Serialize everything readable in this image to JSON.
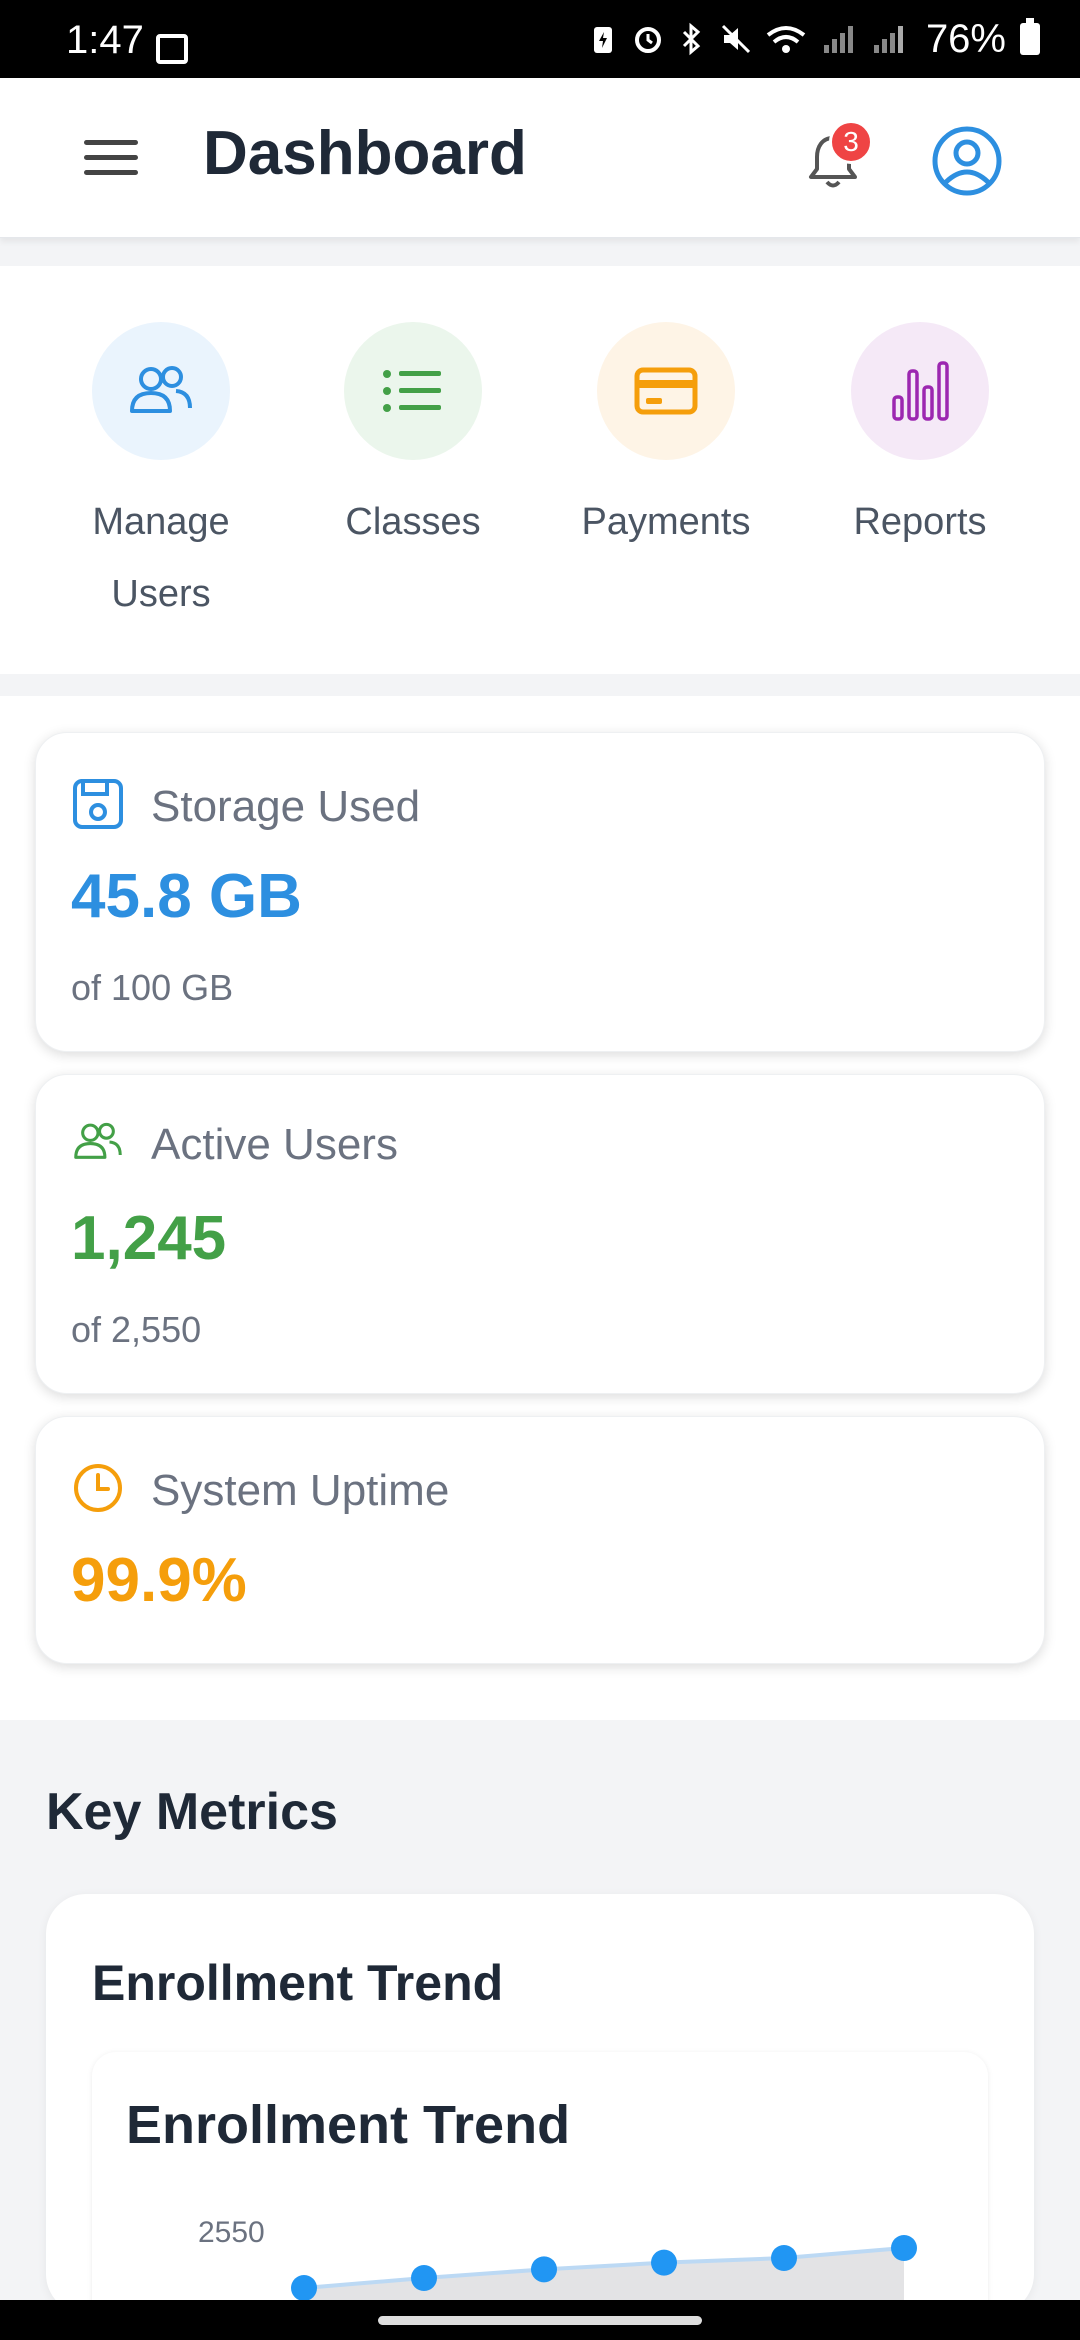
{
  "status_bar": {
    "time": "1:47",
    "battery": "76%"
  },
  "header": {
    "title": "Dashboard",
    "notification_count": "3"
  },
  "quick_actions": [
    {
      "label": "Manage Users",
      "icon": "users-icon",
      "color": "#2d8fe0",
      "bg": "#eaf4fd"
    },
    {
      "label": "Classes",
      "icon": "list-icon",
      "color": "#43a047",
      "bg": "#ebf6ec"
    },
    {
      "label": "Payments",
      "icon": "credit-card-icon",
      "color": "#f59e0b",
      "bg": "#fef4e6"
    },
    {
      "label": "Reports",
      "icon": "bar-chart-icon",
      "color": "#9c27b0",
      "bg": "#f5e9f7"
    }
  ],
  "stats": [
    {
      "label": "Storage Used",
      "value": "45.8 GB",
      "sub": "of 100 GB",
      "icon": "save-icon",
      "color": "#2d8fe0"
    },
    {
      "label": "Active Users",
      "value": "1,245",
      "sub": "of 2,550",
      "icon": "users-icon",
      "color": "#43a047"
    },
    {
      "label": "System Uptime",
      "value": "99.9%",
      "sub": "",
      "icon": "clock-icon",
      "color": "#f59e0b"
    }
  ],
  "key_metrics": {
    "title": "Key Metrics",
    "card_title": "Enrollment Trend"
  },
  "chart_data": {
    "type": "area",
    "title": "Enrollment Trend",
    "y_tick_labels": [
      "2550"
    ],
    "values": [
      2490,
      2505,
      2518,
      2528,
      2535,
      2550
    ],
    "color": "#2196f3"
  }
}
